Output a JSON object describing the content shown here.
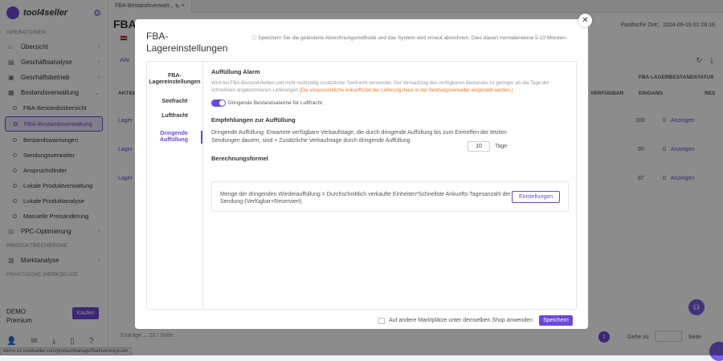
{
  "sidebar": {
    "brand": "tool4seller",
    "section_operations": "OPERATIONEN",
    "menu": [
      {
        "label": "Übersicht",
        "icon": "home-icon"
      },
      {
        "label": "Geschäftsanalyse",
        "icon": "chart-icon"
      },
      {
        "label": "Geschäftsbetrieb",
        "icon": "briefcase-icon"
      },
      {
        "label": "Bestandsverwaltung",
        "icon": "box-icon"
      }
    ],
    "submenu": [
      "FBA-Bestandsübersicht",
      "FBA-Bestandsverwaltung",
      "Bestandswarnungen",
      "Sendungsverwalter",
      "Anspruchsfinder",
      "Lokale Produktverwaltung",
      "Lokale Produktanalyse",
      "Manuelle Preisänderung"
    ],
    "ppc": "PPC-Optimierung",
    "section_research": "PRODUKTRECHERCHE",
    "marktanalyse": "Marktanalyse",
    "section_tools": "PRAKTISCHE WERKZEUGE",
    "user_name": "DEMO",
    "user_plan": "Premium",
    "buy_label": "Kaufen",
    "status_url": "demo-v2.tool4seller.com/productManage/fbaInventoryList#"
  },
  "main": {
    "tab_label": "FBA-Bestandsverwalt...",
    "page_title": "FBA-",
    "timezone": "Pazifische Zeit：2024-09-19 01:26:16",
    "all_tab": "Alle",
    "headers": {
      "action": "AKTION",
      "available": "VERFÜGBAR",
      "inbound": "EINGANG",
      "fba_status": "FBA LAGERBESTANDSTATUS",
      "res": "RES"
    },
    "rows": [
      {
        "left": "Lager",
        "available": "100",
        "inbound": "0",
        "link": "Anzeigen"
      },
      {
        "left": "Lager",
        "available": "90",
        "inbound": "0",
        "link": "Anzeigen"
      },
      {
        "left": "Lager",
        "available": "87",
        "inbound": "0",
        "link": "Anzeigen"
      }
    ],
    "pager_text": "Einträge ... 20 / Seite",
    "current_page": "1",
    "goto_label": "Gehe zu",
    "goto_suffix": "Seite"
  },
  "modal": {
    "title": "FBA-Lagereinstellungen",
    "hint": "ⓘ Speichern Sie die geänderte Abrechnungsmethode und das System wird erneut abrechnen. Dies dauert normalerweise 5-10 Minuten.",
    "nav": [
      "FBA-Lagereinstellungen",
      "Seefracht",
      "Luftfracht",
      "Dringende Auffüllung"
    ],
    "alarm_title": "Auffüllung Alarm",
    "alarm_text": "Wird bei FBA-Bestandsfehlen und nicht rechtzeitig zusätzlicher Seefracht verwendet. Der Verkaufstag des verfügbaren Bestandes ist geringer als die Tage der schnellsten angekommenen Lieferungen",
    "alarm_warn": "(Die voraussichtliche Ankunftszeit der Lieferung muss in der Sendungsverwalter eingestellt werden.)",
    "toggle_label": "Dringende Bestandsalarme für Luftfracht",
    "rec_title": "Empfehlungen zur Auffüllung",
    "rec_text": "Dringende Auffüllung: Erwartete verfügbare Verkaufstage, die durch dringende Auffüllung bis zum Eintreffen der letzten Sendungen dauern, sind + Zusätzliche Verkaufstage durch dringende Auffüllung",
    "days_value": "10",
    "days_suffix": "Tage",
    "formula_title": "Berechnungsformel",
    "formula_text": "Menge der dringenden Wiederauffüllung = Durchschnittlich verkaufte Einheiten*Schnellste Ankunfts-Tagesanzahl der Sendung-(Verfügbar+Reserviert)",
    "settings_btn": "Einstellungen",
    "apply_label": "Auf andere Marktplätze unter demselben Shop anwenden",
    "save_label": "Speichern",
    "close_glyph": "✕"
  },
  "colors": {
    "accent": "#6c47d8",
    "warning": "#e67a1e"
  }
}
